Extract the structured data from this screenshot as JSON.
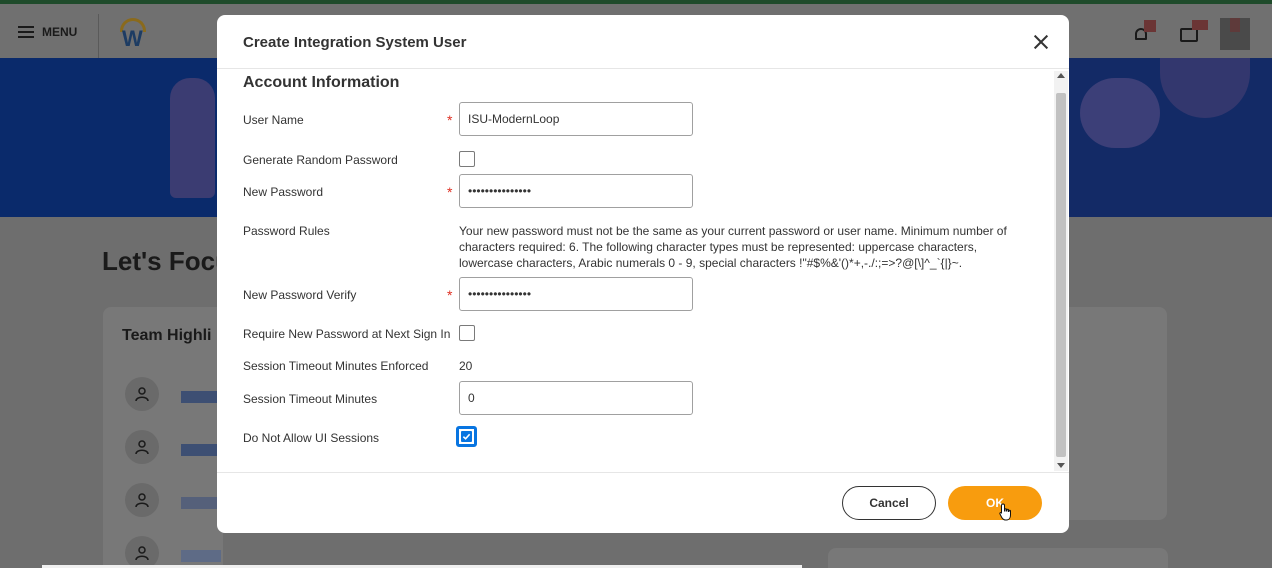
{
  "app": {
    "menu_label": "MENU",
    "logo_letter": "W"
  },
  "background": {
    "focus_title": "Let's Focu",
    "team_title": "Team Highli"
  },
  "modal": {
    "title": "Create Integration System User",
    "section_title": "Account Information",
    "fields": {
      "user_name": {
        "label": "User Name",
        "value": "ISU-ModernLoop",
        "required": "*"
      },
      "generate_random_password": {
        "label": "Generate Random Password",
        "checked": false
      },
      "new_password": {
        "label": "New Password",
        "value": "•••••••••••••••",
        "required": "*"
      },
      "password_rules": {
        "label": "Password Rules",
        "text": "Your new password must not be the same as your current password or user name. Minimum number of characters required: 6. The following character types must be represented: uppercase characters, lowercase characters, Arabic numerals 0 - 9, special characters !\"#$%&'()*+,-./:;=>?@[\\]^_`{|}~."
      },
      "new_password_verify": {
        "label": "New Password Verify",
        "value": "•••••••••••••••",
        "required": "*"
      },
      "require_new_password": {
        "label": "Require New Password at Next Sign In",
        "checked": false
      },
      "session_timeout_enforced": {
        "label": "Session Timeout Minutes Enforced",
        "value": "20"
      },
      "session_timeout_minutes": {
        "label": "Session Timeout Minutes",
        "value": "0"
      },
      "do_not_allow_ui": {
        "label": "Do Not Allow UI Sessions",
        "checked": true
      }
    },
    "buttons": {
      "cancel": "Cancel",
      "ok": "OK"
    }
  },
  "colors": {
    "ok_button": "#f89c0e",
    "required_star": "#de2e21",
    "checkbox_accent": "#0875e1"
  }
}
